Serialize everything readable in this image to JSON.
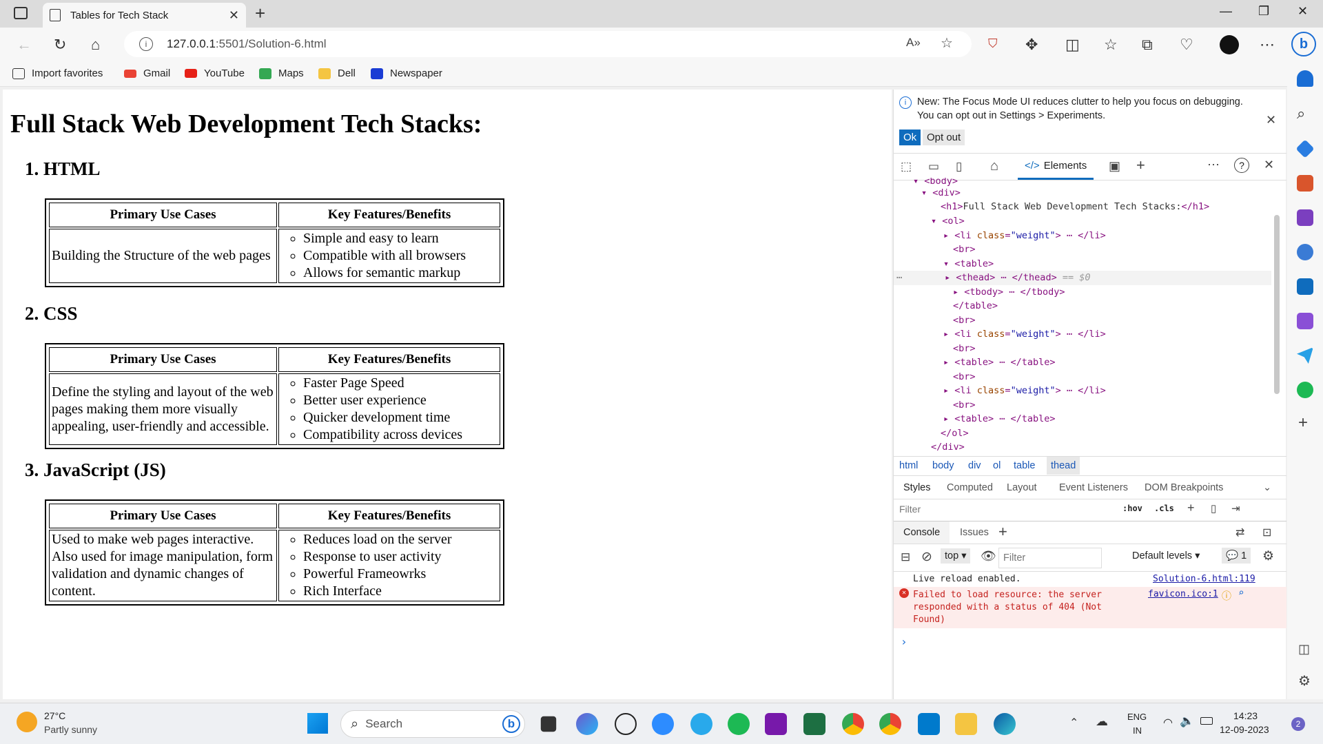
{
  "browser": {
    "tab_title": "Tables for Tech Stack",
    "url_host": "127.0.0.1",
    "url_rest": ":5501/Solution-6.html",
    "favorites": [
      "Import favorites",
      "Gmail",
      "YouTube",
      "Maps",
      "Dell",
      "Newspaper"
    ]
  },
  "page": {
    "heading": "Full Stack Web Development Tech Stacks:",
    "col_use": "Primary Use Cases",
    "col_features": "Key Features/Benefits",
    "sections": [
      {
        "title": "1. HTML",
        "use_case": "Building the Structure of the web pages",
        "features": [
          "Simple and easy to learn",
          "Compatible with all browsers",
          "Allows for semantic markup"
        ]
      },
      {
        "title": "2. CSS",
        "use_case": "Define the styling and layout of the web pages making them more visually appealing, user-friendly and accessible.",
        "features": [
          "Faster Page Speed",
          "Better user experience",
          "Quicker development time",
          "Compatibility across devices"
        ]
      },
      {
        "title": "3. JavaScript (JS)",
        "use_case": "Used to make web pages interactive. Also used for image manipulation, form validation and dynamic changes of content.",
        "features": [
          "Reduces load on the server",
          "Response to user activity",
          "Powerful Frameowrks",
          "Rich Interface"
        ]
      }
    ]
  },
  "devtools": {
    "notice_line1": "New: The Focus Mode UI reduces clutter to help you focus on debugging.",
    "notice_line2": "You can opt out in Settings > Experiments.",
    "ok_label": "Ok",
    "optout_label": "Opt out",
    "elements_tab": "Elements",
    "dom_h1_text": "Full Stack Web Development Tech Stacks:",
    "dom_selected_marker": "== $0",
    "breadcrumbs": [
      "html",
      "body",
      "div",
      "ol",
      "table",
      "thead"
    ],
    "style_tabs": [
      "Styles",
      "Computed",
      "Layout",
      "Event Listeners",
      "DOM Breakpoints"
    ],
    "filter_placeholder": "Filter",
    "hov": ":hov",
    "cls": ".cls",
    "console_tabs": [
      "Console",
      "Issues"
    ],
    "context": "top",
    "console_filter_placeholder": "Filter",
    "levels": "Default levels",
    "issue_count": "1",
    "log_live": "Live reload enabled.",
    "log_live_src": "Solution-6.html:119",
    "log_err_lines": [
      "Failed to load resource: the server",
      "responded with a status of 404 (Not",
      "Found)"
    ],
    "log_err_src": "favicon.ico:1"
  },
  "taskbar": {
    "temp": "27°C",
    "weather": "Partly sunny",
    "search_placeholder": "Search",
    "lang1": "ENG",
    "lang2": "IN",
    "time": "14:23",
    "date": "12-09-2023",
    "notif": "2"
  }
}
